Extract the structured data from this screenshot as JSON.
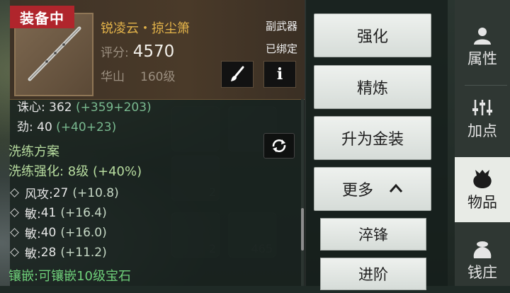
{
  "header": {
    "equipped_badge": "装备中",
    "item_name": "锐凌云・掠尘箫",
    "score_label": "评分:",
    "score_value": "4570",
    "sect": "华山",
    "level": "160级",
    "slot_type": "副武器",
    "bound_status": "已绑定",
    "info_glyph": "i"
  },
  "stats": [
    {
      "label": "诛心: ",
      "base": "362",
      "bonus": " (+359+203)"
    },
    {
      "label": "劲: ",
      "base": "40",
      "bonus": " (+40+23)"
    }
  ],
  "refine": {
    "title": "洗练方案",
    "strength": "洗练强化: 8级 (+40%)",
    "items": [
      {
        "label": "风攻: ",
        "value": "27",
        "bonus": "(+10.8)"
      },
      {
        "label": "敏: ",
        "value": "41",
        "bonus": "(+16.4)"
      },
      {
        "label": "敏: ",
        "value": "40",
        "bonus": "(+16.0)"
      },
      {
        "label": "敏: ",
        "value": "28",
        "bonus": "(+11.2)"
      }
    ]
  },
  "socket_text": "镶嵌:可镶嵌10级宝石",
  "background_slots": [
    "2",
    "5",
    "2",
    "465"
  ],
  "actions": {
    "enhance": "强化",
    "smelt": "精炼",
    "upgrade_gold": "升为金装",
    "more": "更多",
    "temper": "淬锋",
    "advance": "进阶"
  },
  "nav": {
    "attributes": "属性",
    "add_points": "加点",
    "items": "物品",
    "shop": "钱庄"
  },
  "colors": {
    "badge": "#b0252c",
    "item_name": "#e4b44a",
    "bonus": "#79b98f",
    "refine": "#b7dc9f",
    "socket": "#6fd07a"
  }
}
